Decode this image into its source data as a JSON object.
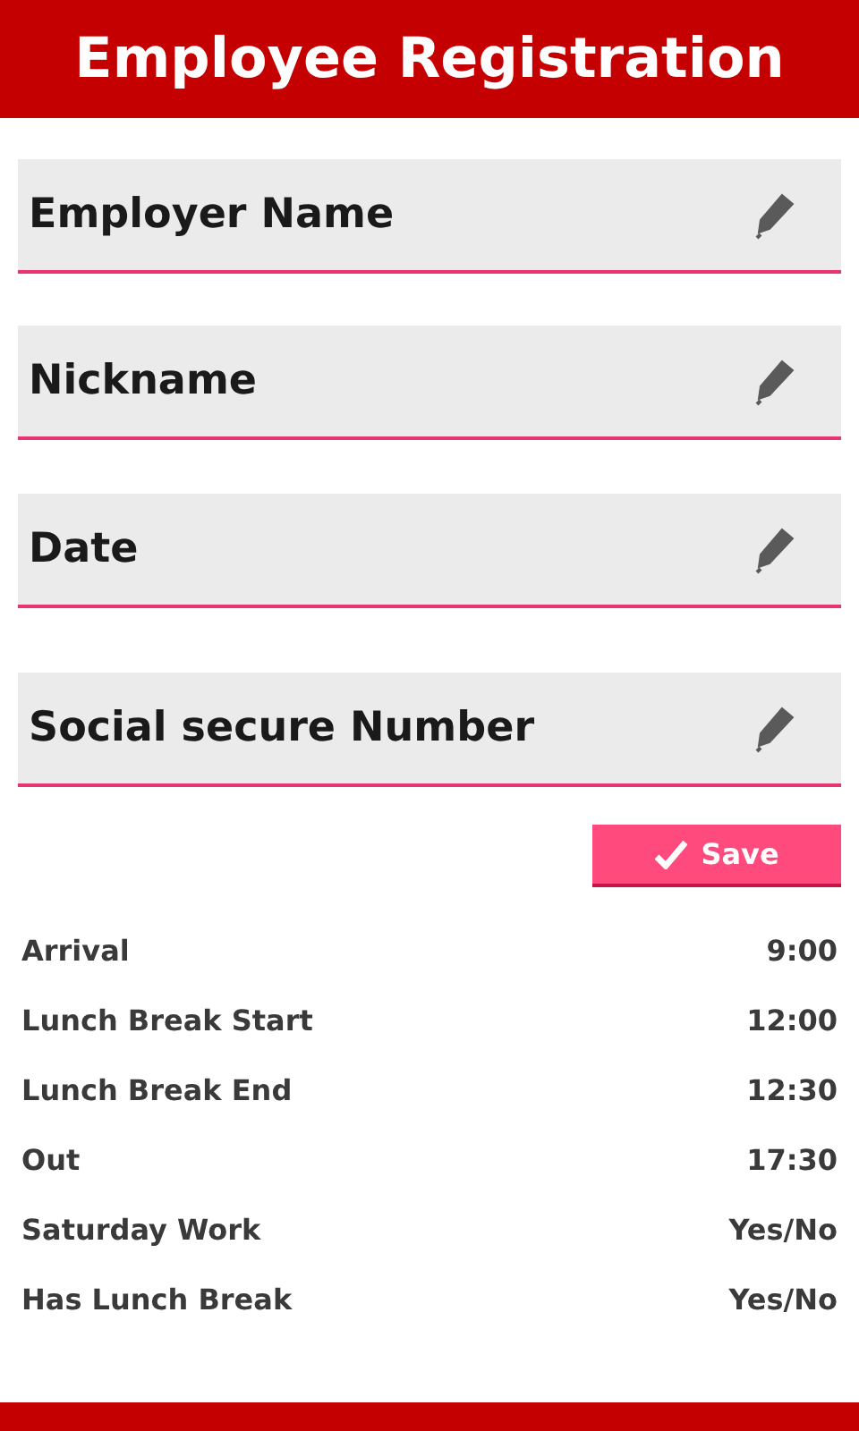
{
  "header": {
    "title": "Employee Registration"
  },
  "fields": [
    {
      "placeholder": "Employer Name"
    },
    {
      "placeholder": "Nickname"
    },
    {
      "placeholder": "Date"
    },
    {
      "placeholder": "Social secure Number"
    }
  ],
  "save_button": {
    "label": "Save"
  },
  "schedule": [
    {
      "label": "Arrival",
      "value": "9:00"
    },
    {
      "label": "Lunch Break Start",
      "value": "12:00"
    },
    {
      "label": "Lunch Break End",
      "value": "12:30"
    },
    {
      "label": "Out",
      "value": "17:30"
    },
    {
      "label": "Saturday Work",
      "value": "Yes/No"
    },
    {
      "label": "Has Lunch Break",
      "value": "Yes/No"
    }
  ]
}
